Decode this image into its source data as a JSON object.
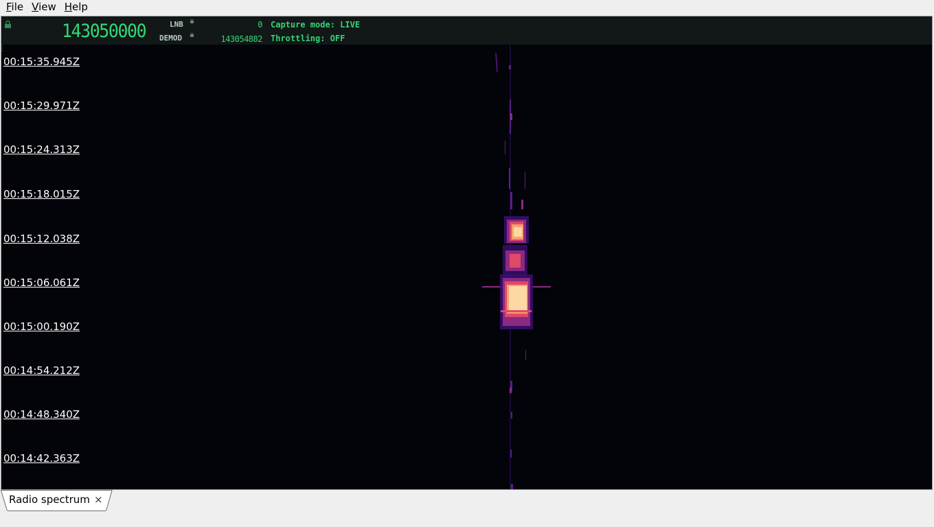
{
  "menu": {
    "file": {
      "mnemonic": "F",
      "rest": "ile"
    },
    "view": {
      "mnemonic": "V",
      "rest": "iew"
    },
    "help": {
      "mnemonic": "H",
      "rest": "elp"
    }
  },
  "header": {
    "frequency": "143050000",
    "lnb_label": "LNB",
    "lnb_value": "0",
    "demod_label": "DEMOD",
    "demod_value": "143054882",
    "capture_mode": "Capture mode: LIVE",
    "throttling": "Throttling: OFF",
    "accent_color": "#35d777"
  },
  "waterfall": {
    "timestamps": [
      "00:15:35.945Z",
      "00:15:29.971Z",
      "00:15:24.313Z",
      "00:15:18.015Z",
      "00:15:12.038Z",
      "00:15:06.061Z",
      "00:15:00.190Z",
      "00:14:54.212Z",
      "00:14:48.340Z",
      "00:14:42.363Z"
    ],
    "colormap": [
      "#03030a",
      "#3b0f70",
      "#8c2981",
      "#de4968",
      "#fe9f6d",
      "#fcd9a4"
    ]
  },
  "tabs": [
    {
      "label": "Radio spectrum",
      "close": "×"
    }
  ]
}
